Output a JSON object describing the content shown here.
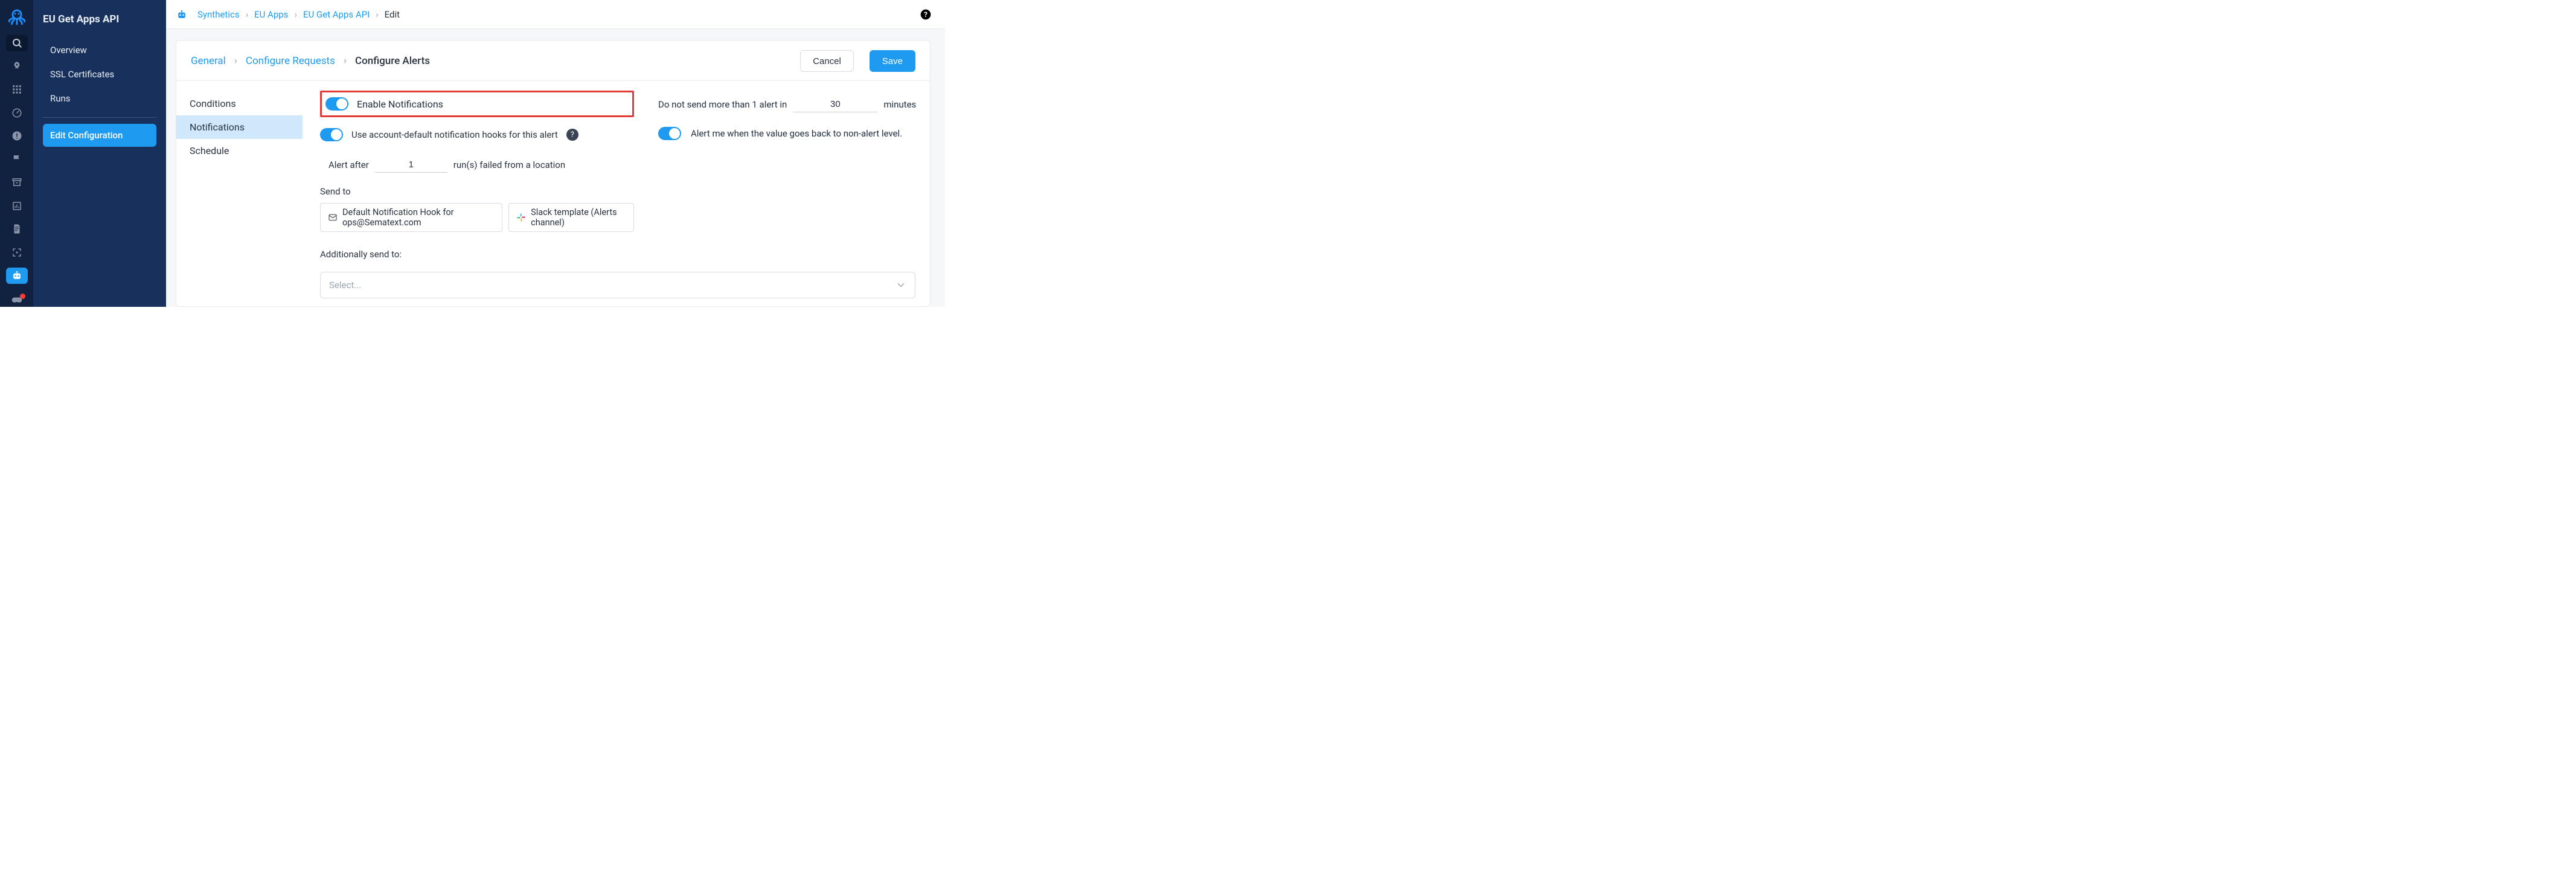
{
  "app_title": "EU Get Apps API",
  "sidebar": {
    "items": [
      "Overview",
      "SSL Certificates",
      "Runs",
      "Edit Configuration"
    ],
    "active_index": 3
  },
  "breadcrumbs": {
    "items": [
      "Synthetics",
      "EU Apps",
      "EU Get Apps API",
      "Edit"
    ]
  },
  "step_tabs": {
    "items": [
      "General",
      "Configure Requests",
      "Configure Alerts"
    ],
    "active_index": 2
  },
  "buttons": {
    "cancel": "Cancel",
    "save": "Save"
  },
  "left_tabs": {
    "items": [
      "Conditions",
      "Notifications",
      "Schedule"
    ],
    "active_index": 1
  },
  "notifications": {
    "enable_label": "Enable Notifications",
    "default_hooks_label": "Use account-default notification hooks for this alert",
    "alert_after_prefix": "Alert after",
    "alert_after_value": "1",
    "alert_after_suffix": "run(s) failed from a location",
    "send_to_label": "Send to",
    "hooks": [
      {
        "icon": "mail-icon",
        "label": "Default Notification Hook for ops@Sematext.com"
      },
      {
        "icon": "slack-icon",
        "label": "Slack template (Alerts channel)"
      }
    ],
    "additional_label": "Additionally send to:",
    "select_placeholder": "Select..."
  },
  "throttle": {
    "prefix": "Do not send more than 1 alert in",
    "value": "30",
    "unit": "minutes"
  },
  "recovery": {
    "label": "Alert me when the value goes back to non-alert level."
  }
}
